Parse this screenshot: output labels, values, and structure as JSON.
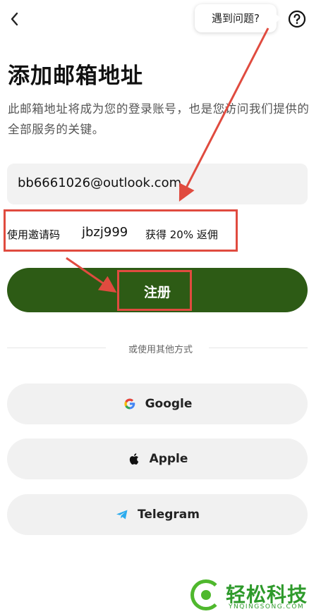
{
  "header": {
    "help_bubble_text": "遇到问题?",
    "back_icon": "chevron-left-icon",
    "help_icon": "question-circle-icon"
  },
  "main": {
    "title": "添加邮箱地址",
    "description": "此邮箱地址将成为您的登录账号，也是您访问我们提供的全部服务的关键。",
    "email_value": "bb6661026@outlook.com",
    "invite": {
      "label": "使用邀请码",
      "code": "jbzj999",
      "rebate": "获得 20% 返佣"
    },
    "register_label": "注册",
    "divider_text": "或使用其他方式",
    "social": [
      {
        "label": "Google",
        "icon": "google-icon"
      },
      {
        "label": "Apple",
        "icon": "apple-icon"
      },
      {
        "label": "Telegram",
        "icon": "telegram-icon"
      }
    ]
  },
  "watermark": {
    "brand": "轻松科技",
    "domain": "YNQINGSONG.COM"
  },
  "colors": {
    "primary_green": "#2d5b15",
    "annotation_red": "#e04b3f",
    "watermark_green": "#2e9a2b"
  }
}
